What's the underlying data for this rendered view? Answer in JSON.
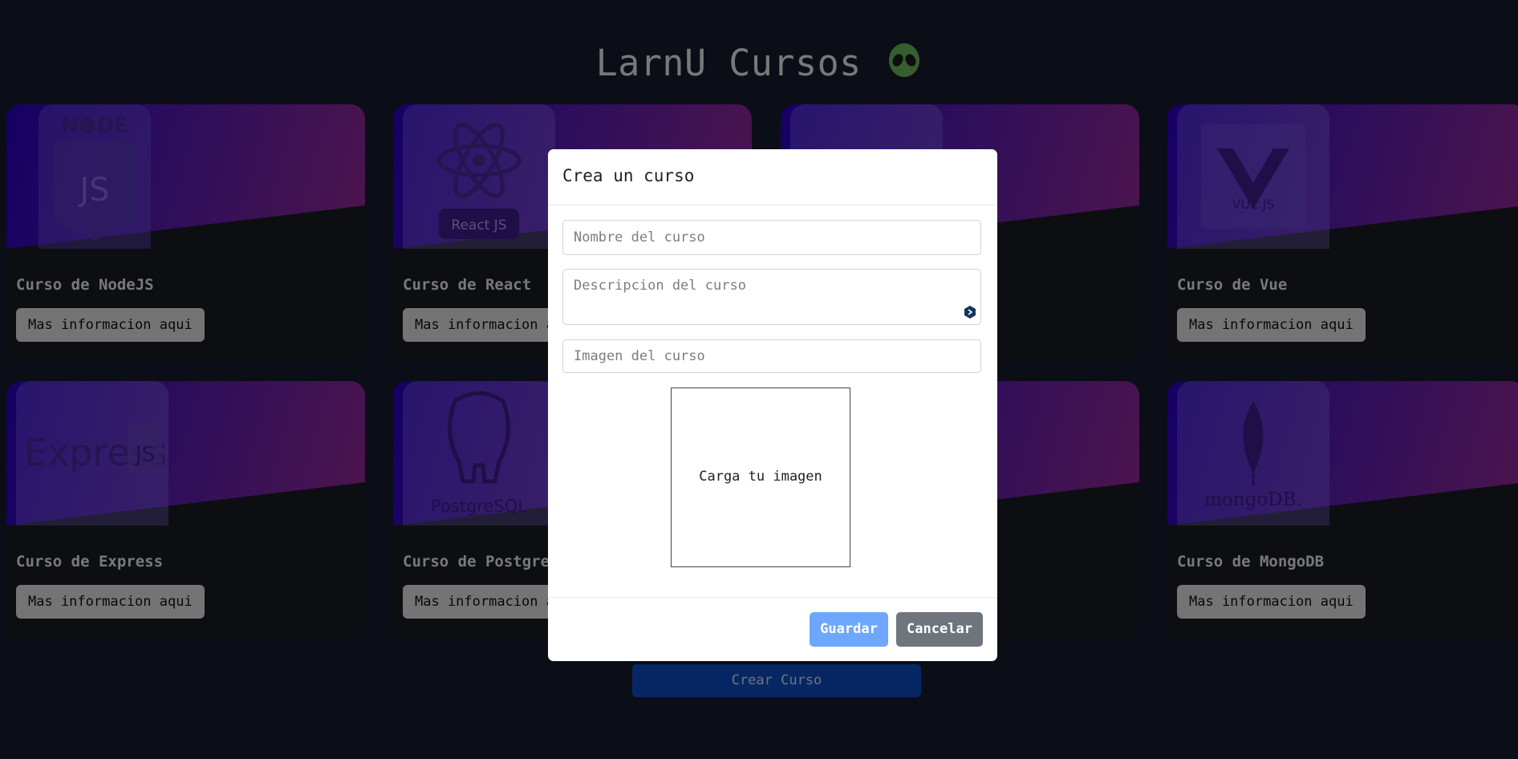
{
  "header": {
    "title": "LarnU Cursos"
  },
  "cards": [
    {
      "name": "Curso de NodeJS",
      "button": "Mas informacion aqui",
      "logo_text": "NODE"
    },
    {
      "name": "Curso de React",
      "button": "Mas informacion aqui",
      "logo_text": "React JS"
    },
    {
      "name": "",
      "button": "",
      "logo_text": ""
    },
    {
      "name": "Curso de Vue",
      "button": "Mas informacion aqui",
      "logo_text": "VUE.JS"
    },
    {
      "name": "Curso de Express",
      "button": "Mas informacion aqui",
      "logo_text": "Express"
    },
    {
      "name": "Curso de Postgre",
      "button": "Mas informacion a",
      "logo_text": "PostgreSQL"
    },
    {
      "name": "",
      "button": "",
      "logo_text": ""
    },
    {
      "name": "Curso de MongoDB",
      "button": "Mas informacion aqui",
      "logo_text": "mongoDB."
    }
  ],
  "create_button": "Crear Curso",
  "modal": {
    "title": "Crea un curso",
    "name_placeholder": "Nombre del curso",
    "description_placeholder": "Descripcion del curso",
    "image_placeholder": "Imagen del curso",
    "preview_text": "Carga tu imagen",
    "save_label": "Guardar",
    "cancel_label": "Cancelar"
  },
  "icons": {
    "header_emoji": "alien-icon",
    "grammar": "grammar-extension-icon"
  },
  "colors": {
    "background": "#161d2e",
    "primary": "#0d4ec7",
    "save": "#6ea7fc",
    "cancel": "#6e757c"
  }
}
